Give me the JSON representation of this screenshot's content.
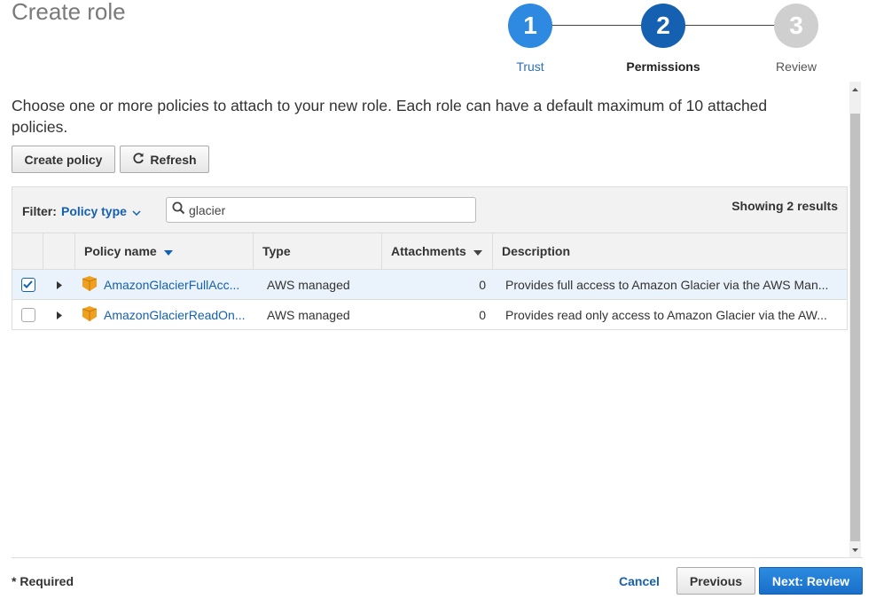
{
  "page": {
    "title": "Create role"
  },
  "stepper": {
    "steps": [
      {
        "number": "1",
        "label": "Trust"
      },
      {
        "number": "2",
        "label": "Permissions"
      },
      {
        "number": "3",
        "label": "Review"
      }
    ]
  },
  "intro_text": "Choose one or more policies to attach to your new role. Each role can have a default maximum of 10 attached policies.",
  "toolbar": {
    "create_policy_label": "Create policy",
    "refresh_label": "Refresh"
  },
  "filter": {
    "label": "Filter:",
    "selected": "Policy type",
    "search_value": "glacier",
    "results_text": "Showing 2 results"
  },
  "table": {
    "columns": [
      "Policy name",
      "Type",
      "Attachments",
      "Description"
    ],
    "rows": [
      {
        "selected": true,
        "name": "AmazonGlacierFullAcc...",
        "type": "AWS managed",
        "attachments": "0",
        "description": "Provides full access to Amazon Glacier via the AWS Man..."
      },
      {
        "selected": false,
        "name": "AmazonGlacierReadOn...",
        "type": "AWS managed",
        "attachments": "0",
        "description": "Provides read only access to Amazon Glacier via the AW..."
      }
    ]
  },
  "footer": {
    "required_label": "* Required",
    "cancel_label": "Cancel",
    "previous_label": "Previous",
    "next_label": "Next: Review"
  },
  "colors": {
    "accent": "#1560b0",
    "step_active": "#2d8ae0",
    "step_current": "#1560b0",
    "step_inactive": "#cfcfcf",
    "policy_icon": "#f0a020"
  }
}
